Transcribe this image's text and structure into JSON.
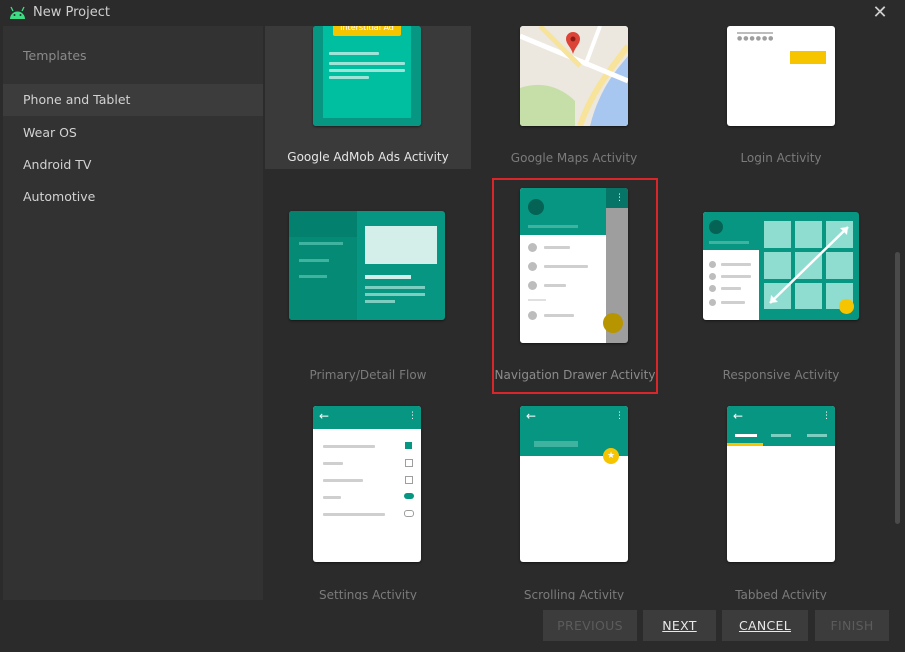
{
  "window": {
    "title": "New Project"
  },
  "sidebar": {
    "header": "Templates",
    "items": [
      {
        "label": "Phone and Tablet",
        "selected": true
      },
      {
        "label": "Wear OS"
      },
      {
        "label": "Android TV"
      },
      {
        "label": "Automotive"
      }
    ]
  },
  "templates": [
    {
      "label": "Google AdMob Ads Activity",
      "badge": "Interstitial Ad"
    },
    {
      "label": "Google Maps Activity"
    },
    {
      "label": "Login Activity"
    },
    {
      "label": "Primary/Detail Flow"
    },
    {
      "label": "Navigation Drawer Activity",
      "highlighted": true
    },
    {
      "label": "Responsive Activity"
    },
    {
      "label": "Settings Activity"
    },
    {
      "label": "Scrolling Activity"
    },
    {
      "label": "Tabbed Activity"
    }
  ],
  "buttons": {
    "previous": "PREVIOUS",
    "next": "NEXT",
    "cancel": "CANCEL",
    "finish": "FINISH"
  },
  "colors": {
    "teal": "#079681",
    "accent_yellow": "#f7c400",
    "highlight_red": "#d8262b"
  }
}
